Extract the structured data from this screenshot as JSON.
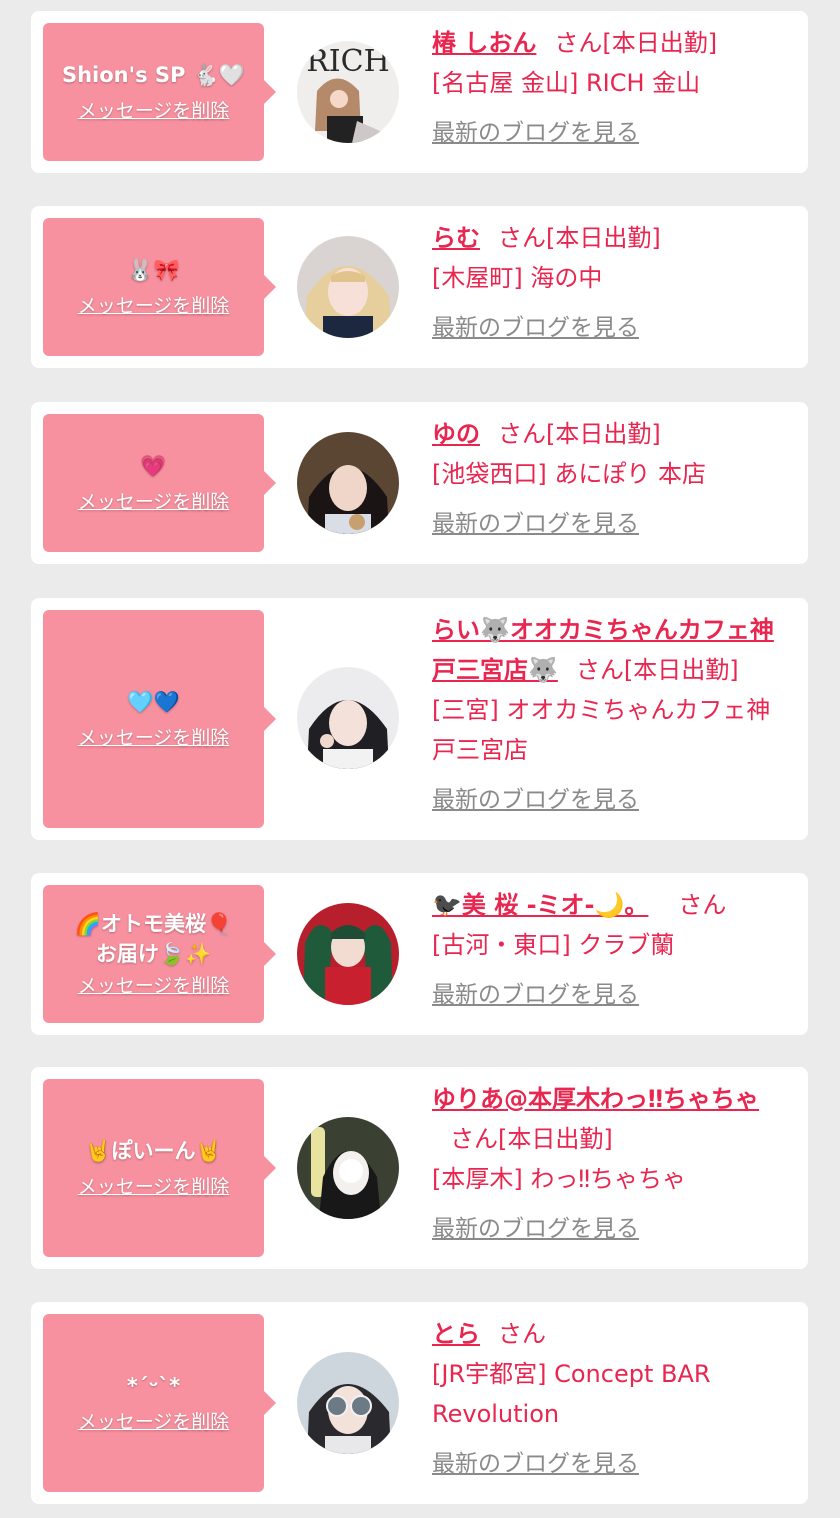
{
  "ui": {
    "delete_label": "メッセージを削除",
    "blog_label": "最新のブログを見る",
    "status_suffix_working": "さん[本日出勤]",
    "status_suffix_plain": "さん"
  },
  "colors": {
    "accent": "#e8264f",
    "bubble": "#f8919f",
    "link_gray": "#8a8a8a",
    "background": "#ebebeb"
  },
  "items": [
    {
      "message": "Shion's SP 🐇🤍",
      "name": "椿 しおん",
      "status": "さん[本日出勤]",
      "shop": "[名古屋 金山] RICH 金山",
      "avatar": "photo-magazine-cover"
    },
    {
      "message": "🐰🎀",
      "name": "らむ",
      "status": "さん[本日出勤]",
      "shop": "[木屋町] 海の中",
      "avatar": "photo-portrait"
    },
    {
      "message": "💗",
      "name": "ゆの",
      "status": "さん[本日出勤]",
      "shop": "[池袋西口] あにぽり 本店",
      "avatar": "photo-portrait"
    },
    {
      "message": "🩵💙",
      "name": "らい🐺オオカミちゃんカフェ神戸三宮店🐺",
      "status": "さん[本日出勤]",
      "shop": "[三宮] オオカミちゃんカフェ神戸三宮店",
      "avatar": "photo-portrait"
    },
    {
      "message": "🌈オトモ美桜🎈\nお届け🍃✨",
      "name": "🐦‍⬛美 桜 -ミオ-🌙。",
      "status": "さん",
      "shop": "[古河・東口] クラブ蘭",
      "avatar": "photo-red-outfit"
    },
    {
      "message": "🤘ぽいーん🤘",
      "name": "ゆりあ@本厚木わっ‼ちゃちゃ",
      "status": "さん[本日出勤]",
      "shop": "[本厚木] わっ‼ちゃちゃ",
      "avatar": "photo-blurred-face"
    },
    {
      "message": "*´ᵕ`*",
      "name": "とら",
      "status": "さん",
      "shop": "[JR宇都宮] Concept BAR Revolution",
      "avatar": "photo-sunglasses"
    }
  ]
}
